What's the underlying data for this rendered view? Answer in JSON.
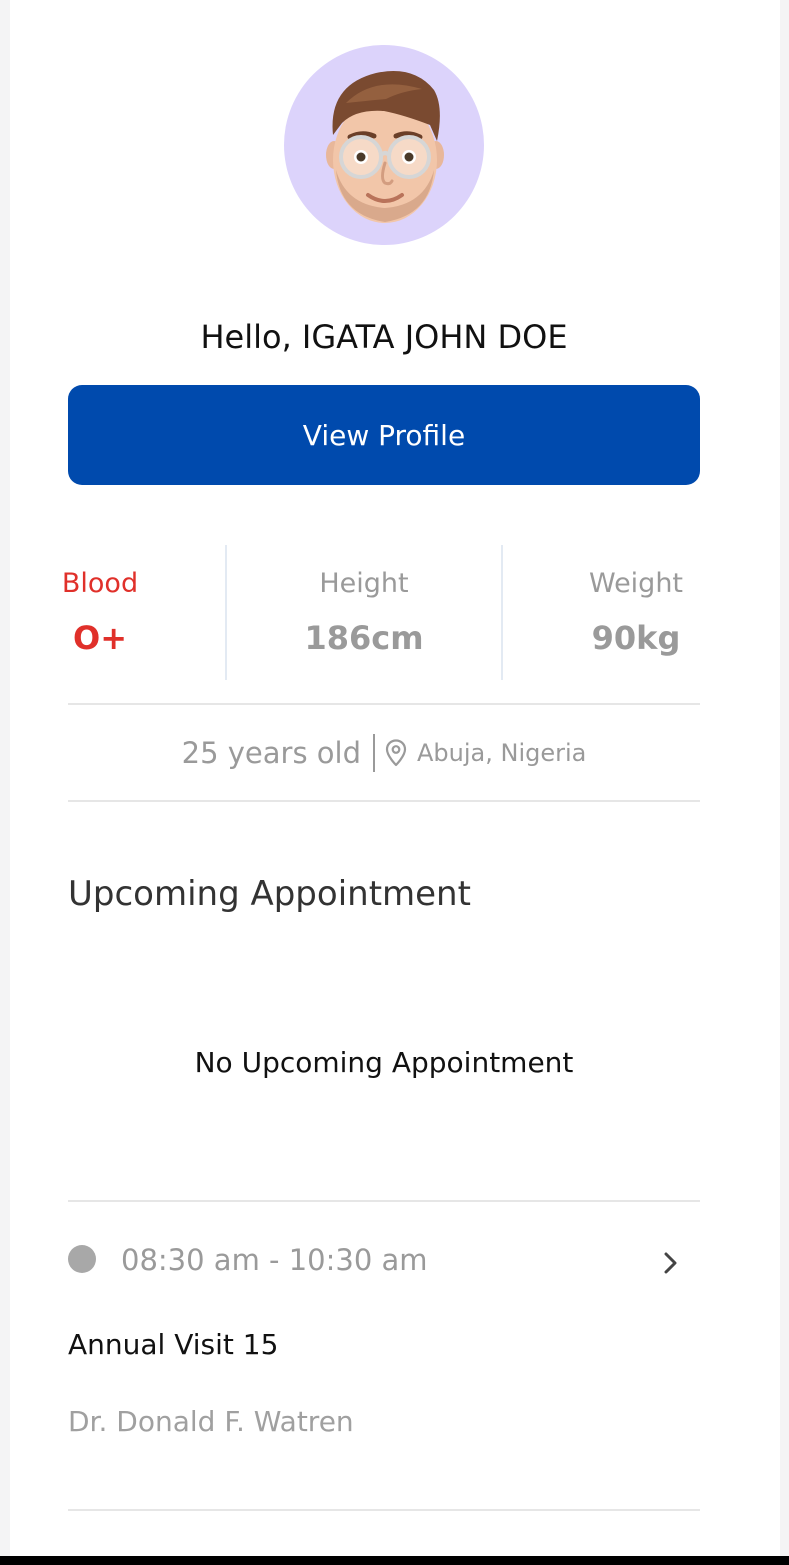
{
  "profile": {
    "greeting": "Hello, IGATA JOHN DOE",
    "view_profile_label": "View Profile",
    "avatar_icon": "memoji-avatar"
  },
  "stats": {
    "blood": {
      "label": "Blood",
      "value": "O+"
    },
    "height": {
      "label": "Height",
      "value": "186cm"
    },
    "weight": {
      "label": "Weight",
      "value": "90kg"
    }
  },
  "info": {
    "age": "25 years old",
    "location_icon": "map-pin-icon",
    "location": "Abuja, Nigeria"
  },
  "appointments": {
    "title": "Upcoming Appointment",
    "empty_message": "No Upcoming Appointment",
    "items": [
      {
        "time": "08:30 am - 10:30 am",
        "title": "Annual Visit 15",
        "doctor": "Dr. Donald F. Watren"
      }
    ]
  },
  "colors": {
    "primary": "#004aad",
    "blood_red": "#e0302a",
    "muted": "#9a9a9a",
    "avatar_bg": "#dcd3fb"
  }
}
